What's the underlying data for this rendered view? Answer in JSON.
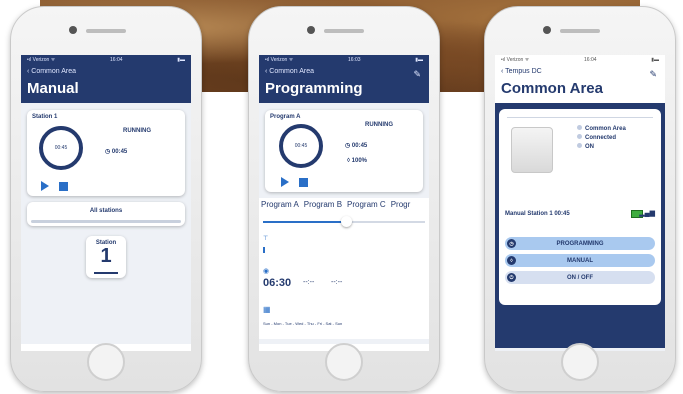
{
  "phone1": {
    "status": {
      "carrier": "•ıl Verizon ᯤ",
      "time": "16:04",
      "battery": "▮▬"
    },
    "back_label": "Common Area",
    "title": "Manual",
    "station_label": "Station 1",
    "running_label": "RUNNING",
    "ring_time": "00:45",
    "clock_time": "00:45",
    "all_stations_label": "All stations",
    "station_tile_label": "Station",
    "station_tile_number": "1"
  },
  "phone2": {
    "status": {
      "carrier": "•ıl Verizon ᯤ",
      "time": "16:03",
      "battery": "▮▬"
    },
    "back_label": "Common Area",
    "title": "Programming",
    "program_label": "Program A",
    "running_label": "RUNNING",
    "ring_time": "00:45",
    "clock_time": "00:45",
    "percent": "100%",
    "tabs": [
      "Program A",
      "Program B",
      "Program C",
      "Progr"
    ],
    "start_time": "06:30",
    "slot2": "--:--",
    "slot3": "--:--",
    "days": "Sun - Mon - Tue - Wed - Thu - Fri - Sat - Sun"
  },
  "phone3": {
    "status": {
      "carrier": "•ıl Verizon ᯤ",
      "time": "16:04",
      "battery": "▮▬"
    },
    "back_label": "Tempus DC",
    "title": "Common Area",
    "info": [
      "Common Area",
      "Connected",
      "ON"
    ],
    "manual_station_text": "Manual Station 1 00:45",
    "buttons": [
      "PROGRAMMING",
      "MANUAL",
      "ON / OFF"
    ]
  }
}
